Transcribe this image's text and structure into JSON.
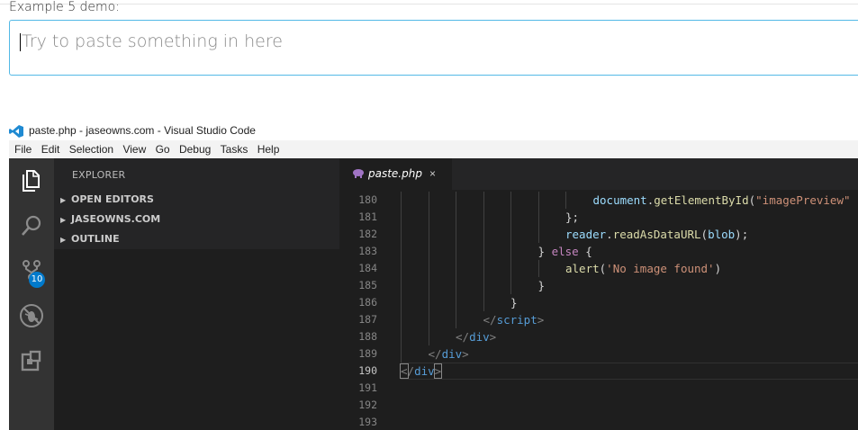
{
  "demo": {
    "title": "Example 5 demo:",
    "placeholder": "Try to paste something in here"
  },
  "window": {
    "title": "paste.php - jaseowns.com - Visual Studio Code"
  },
  "menu": [
    "File",
    "Edit",
    "Selection",
    "View",
    "Go",
    "Debug",
    "Tasks",
    "Help"
  ],
  "activity_bar": {
    "icons": [
      "files-icon",
      "search-icon",
      "source-control-icon",
      "debug-icon",
      "extensions-icon"
    ],
    "scm_badge": "10"
  },
  "sidebar": {
    "title": "EXPLORER",
    "sections": [
      "OPEN EDITORS",
      "JASEOWNS.COM",
      "OUTLINE"
    ]
  },
  "tab": {
    "label": "paste.php",
    "close": "×"
  },
  "code": {
    "active_line": "190",
    "lines": [
      {
        "n": "180",
        "indent": 7,
        "tokens": [
          [
            "document",
            "var"
          ],
          [
            ".",
            "p"
          ],
          [
            "getElementById",
            "fn"
          ],
          [
            "(",
            "p"
          ],
          [
            "\"imagePreview\"",
            "str"
          ]
        ]
      },
      {
        "n": "181",
        "indent": 6,
        "tokens": [
          [
            "};",
            "p"
          ]
        ]
      },
      {
        "n": "182",
        "indent": 6,
        "tokens": [
          [
            "reader",
            "var"
          ],
          [
            ".",
            "p"
          ],
          [
            "readAsDataURL",
            "fn"
          ],
          [
            "(",
            "p"
          ],
          [
            "blob",
            "var"
          ],
          [
            ");",
            "p"
          ]
        ]
      },
      {
        "n": "183",
        "indent": 5,
        "tokens": [
          [
            "} ",
            "p"
          ],
          [
            "else",
            "kw"
          ],
          [
            " {",
            "p"
          ]
        ]
      },
      {
        "n": "184",
        "indent": 6,
        "tokens": [
          [
            "alert",
            "fn"
          ],
          [
            "(",
            "p"
          ],
          [
            "'No image found'",
            "str"
          ],
          [
            ")",
            "p"
          ]
        ]
      },
      {
        "n": "185",
        "indent": 5,
        "tokens": [
          [
            "}",
            "p"
          ]
        ]
      },
      {
        "n": "186",
        "indent": 4,
        "tokens": [
          [
            "}",
            "p"
          ]
        ]
      },
      {
        "n": "187",
        "indent": 3,
        "tokens": [
          [
            "</",
            "br"
          ],
          [
            "script",
            "tag"
          ],
          [
            ">",
            "br"
          ]
        ]
      },
      {
        "n": "188",
        "indent": 2,
        "tokens": [
          [
            "</",
            "br"
          ],
          [
            "div",
            "tag"
          ],
          [
            ">",
            "br"
          ]
        ]
      },
      {
        "n": "189",
        "indent": 1,
        "tokens": [
          [
            "</",
            "br"
          ],
          [
            "div",
            "tag"
          ],
          [
            ">",
            "br"
          ]
        ]
      },
      {
        "n": "190",
        "indent": 0,
        "tokens": [
          [
            "<",
            "hl"
          ],
          [
            "/",
            "br"
          ],
          [
            "div",
            "tag"
          ],
          [
            ">",
            "hl"
          ]
        ]
      },
      {
        "n": "191",
        "indent": 0,
        "tokens": []
      },
      {
        "n": "192",
        "indent": 0,
        "tokens": []
      },
      {
        "n": "193",
        "indent": 0,
        "tokens": []
      }
    ]
  },
  "colors": {
    "accent": "#007acc",
    "input_border": "#53b9e6",
    "editor_bg": "#1e1e1e"
  }
}
